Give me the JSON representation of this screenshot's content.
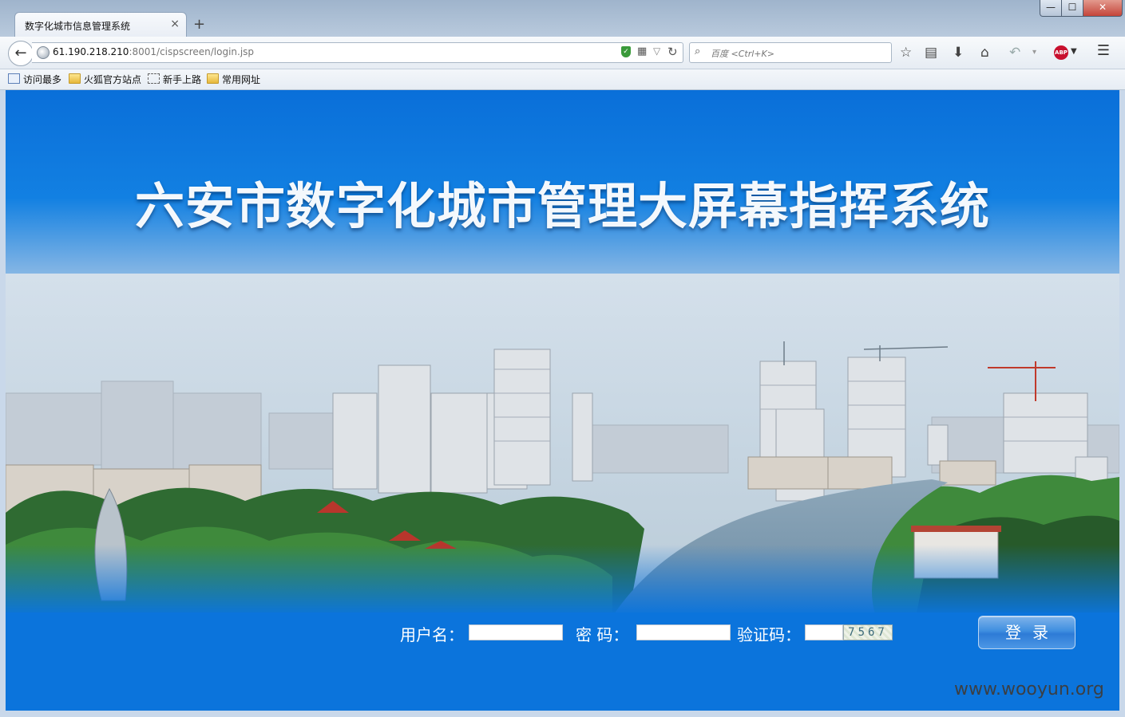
{
  "browser": {
    "tab_title": "数字化城市信息管理系统",
    "tab_close": "×",
    "new_tab": "+",
    "window_controls": {
      "minimize": "—",
      "maximize": "☐",
      "close": "✕"
    },
    "url": {
      "host": "61.190.218.210",
      "rest": ":8001/cispscreen/login.jsp"
    },
    "search_placeholder": "百度 <Ctrl+K>",
    "abp_label": "ABP",
    "bookmarks": [
      "访问最多",
      "火狐官方站点",
      "新手上路",
      "常用网址"
    ]
  },
  "page": {
    "title": "六安市数字化城市管理大屏幕指挥系统",
    "username_label": "用户名：",
    "password_label": "密  码：",
    "captcha_label": "验证码：",
    "captcha_code": "7567",
    "login_button": "登录"
  },
  "watermark": "www.wooyun.org",
  "colors": {
    "page_blue": "#0b74dc",
    "login_button": "#3f8fe0"
  }
}
